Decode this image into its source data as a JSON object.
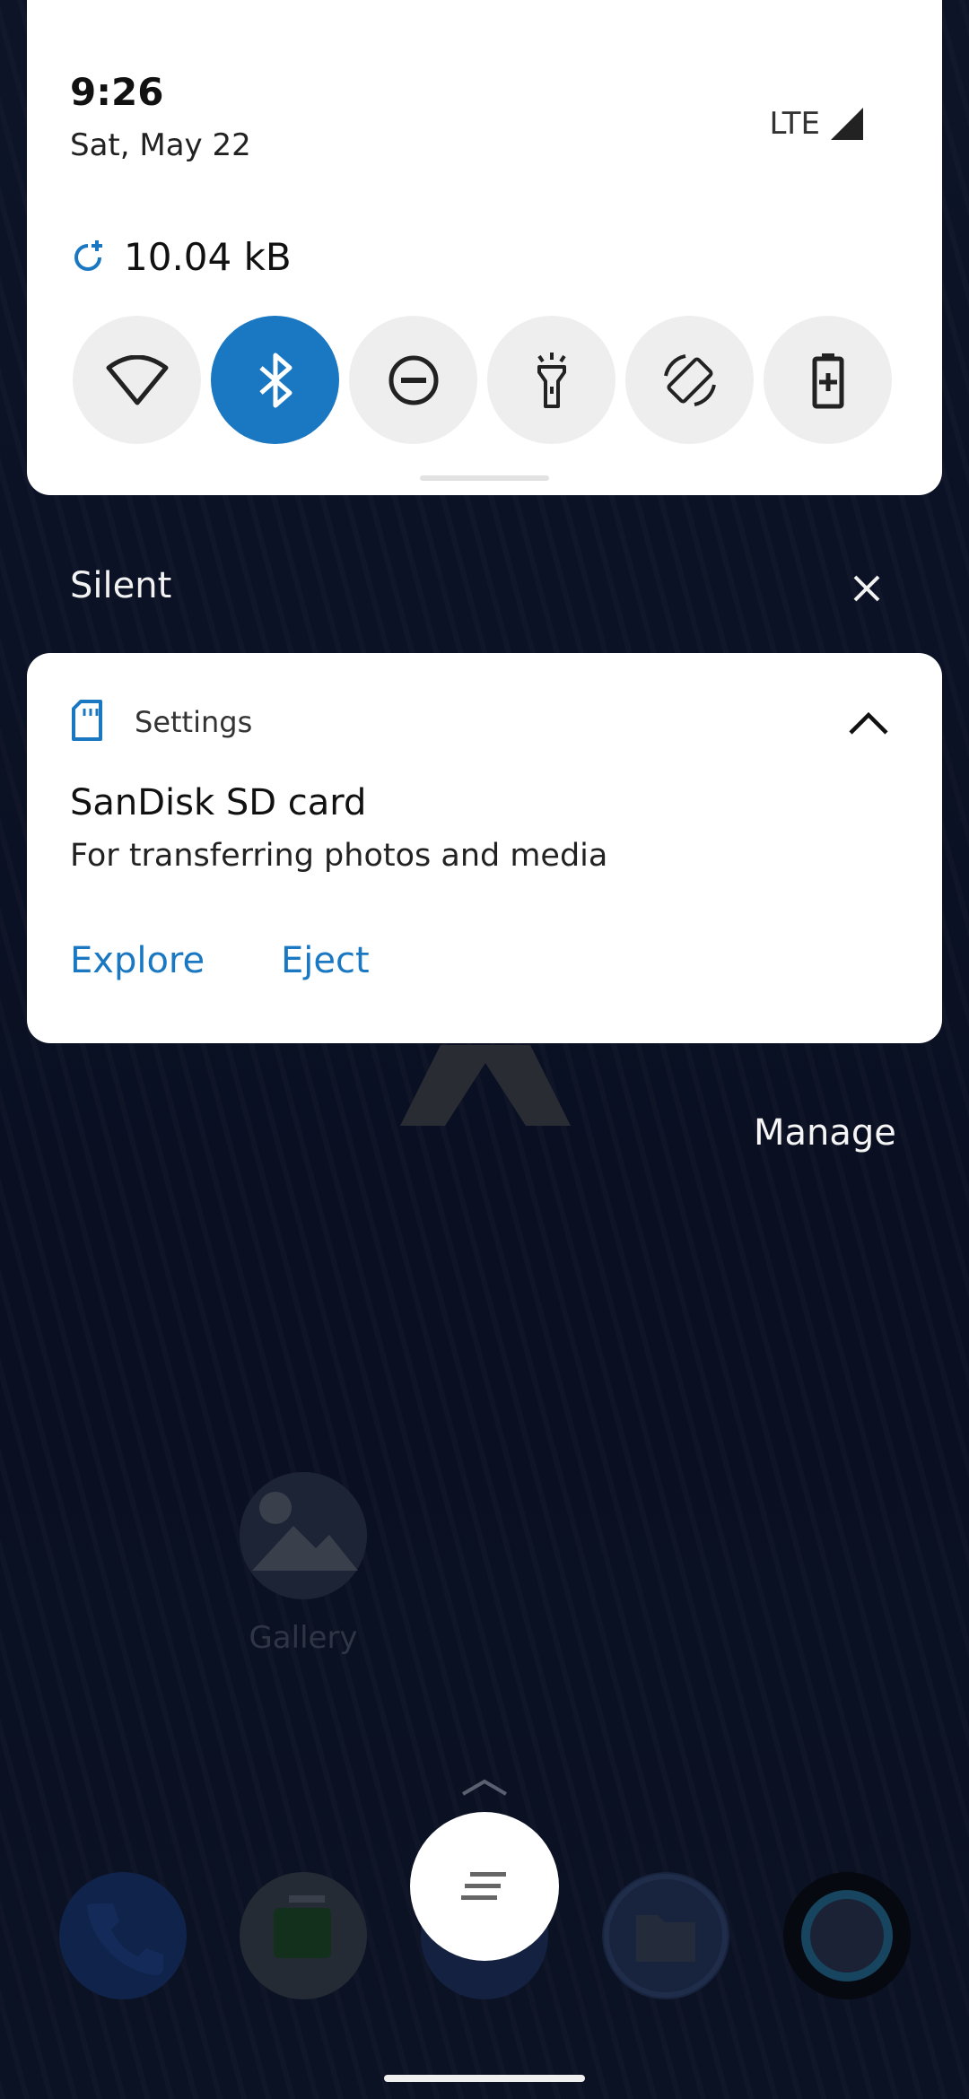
{
  "status": {
    "time": "9:26",
    "date": "Sat, May 22",
    "network": "LTE"
  },
  "data_usage": {
    "amount": "10.04 kB"
  },
  "tiles": [
    {
      "name": "wifi",
      "icon": "wifi-icon",
      "active": false
    },
    {
      "name": "bluetooth",
      "icon": "bluetooth-icon",
      "active": true
    },
    {
      "name": "do-not-disturb",
      "icon": "do-not-disturb-icon",
      "active": false
    },
    {
      "name": "flashlight",
      "icon": "flashlight-icon",
      "active": false
    },
    {
      "name": "auto-rotate",
      "icon": "auto-rotate-icon",
      "active": false
    },
    {
      "name": "battery-saver",
      "icon": "battery-saver-icon",
      "active": false
    }
  ],
  "silent_section": {
    "label": "Silent"
  },
  "notification": {
    "app": "Settings",
    "title": "SanDisk SD card",
    "text": "For transferring photos and media",
    "actions": {
      "explore": "Explore",
      "eject": "Eject"
    }
  },
  "manage": {
    "label": "Manage"
  },
  "launcher": {
    "gallery_label": "Gallery"
  },
  "colors": {
    "accent": "#1a78c2",
    "panel": "#ffffff",
    "wallpaper": "#0b1224"
  }
}
